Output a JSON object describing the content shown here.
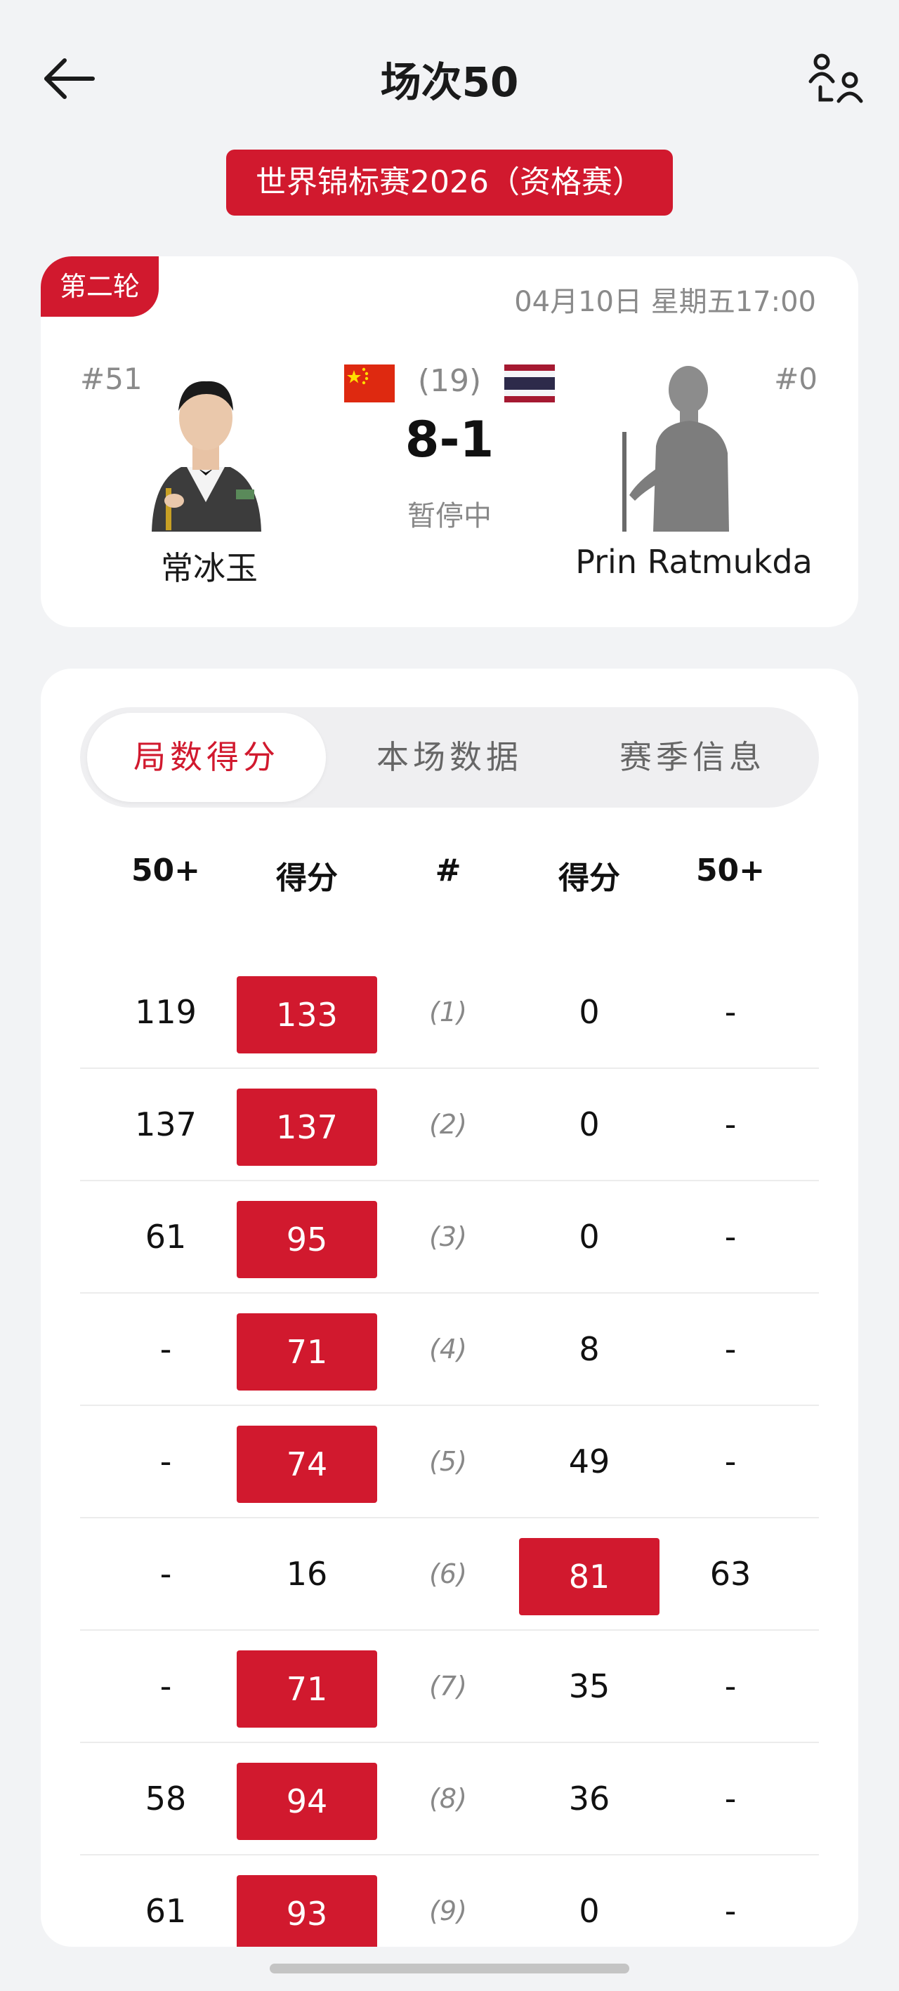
{
  "header": {
    "title": "场次50",
    "back_icon": "arrow-left-icon",
    "switch_icon": "player-switch-icon"
  },
  "tournament": {
    "name": "世界锦标赛2026（资格赛）"
  },
  "match": {
    "round": "第二轮",
    "datetime": "04月10日 星期五17:00",
    "best_of": "(19)",
    "score": "8-1",
    "status": "暂停中",
    "player_left": {
      "rank": "#51",
      "name": "常冰玉",
      "flag": "CN"
    },
    "player_right": {
      "rank": "#0",
      "name": "Prin Ratmukda",
      "flag": "TH"
    }
  },
  "tabs": [
    {
      "label": "局数得分",
      "active": true
    },
    {
      "label": "本场数据",
      "active": false
    },
    {
      "label": "赛季信息",
      "active": false
    }
  ],
  "table": {
    "headers": [
      "50+",
      "得分",
      "#",
      "得分",
      "50+"
    ],
    "rows": [
      {
        "left_breaks": "119",
        "left_score": "133",
        "frame": "(1)",
        "right_score": "0",
        "right_breaks": "-",
        "winner": "left"
      },
      {
        "left_breaks": "137",
        "left_score": "137",
        "frame": "(2)",
        "right_score": "0",
        "right_breaks": "-",
        "winner": "left"
      },
      {
        "left_breaks": "61",
        "left_score": "95",
        "frame": "(3)",
        "right_score": "0",
        "right_breaks": "-",
        "winner": "left"
      },
      {
        "left_breaks": "-",
        "left_score": "71",
        "frame": "(4)",
        "right_score": "8",
        "right_breaks": "-",
        "winner": "left"
      },
      {
        "left_breaks": "-",
        "left_score": "74",
        "frame": "(5)",
        "right_score": "49",
        "right_breaks": "-",
        "winner": "left"
      },
      {
        "left_breaks": "-",
        "left_score": "16",
        "frame": "(6)",
        "right_score": "81",
        "right_breaks": "63",
        "winner": "right"
      },
      {
        "left_breaks": "-",
        "left_score": "71",
        "frame": "(7)",
        "right_score": "35",
        "right_breaks": "-",
        "winner": "left"
      },
      {
        "left_breaks": "58",
        "left_score": "94",
        "frame": "(8)",
        "right_score": "36",
        "right_breaks": "-",
        "winner": "left"
      },
      {
        "left_breaks": "61",
        "left_score": "93",
        "frame": "(9)",
        "right_score": "0",
        "right_breaks": "-",
        "winner": "left"
      }
    ]
  },
  "colors": {
    "accent": "#d1192e",
    "background": "#f2f3f5",
    "card": "#ffffff",
    "muted": "#888888"
  }
}
